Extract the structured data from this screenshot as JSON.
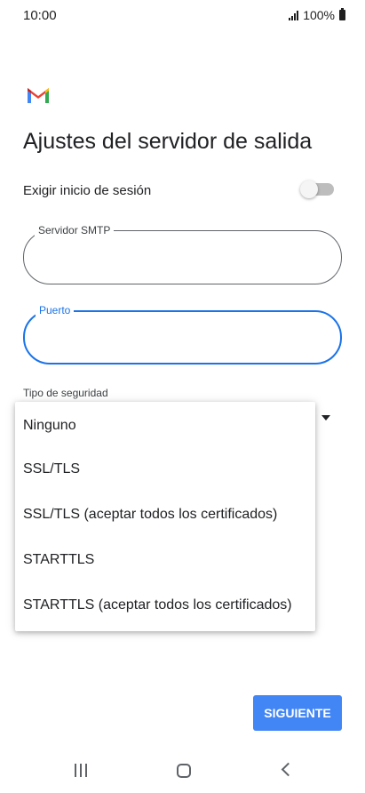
{
  "status_bar": {
    "time": "10:00",
    "battery": "100%"
  },
  "app": {
    "logo_icon": "gmail-logo-icon"
  },
  "page": {
    "title": "Ajustes del servidor de salida"
  },
  "login": {
    "label": "Exigir inicio de sesión",
    "enabled": false
  },
  "fields": {
    "smtp_label": "Servidor SMTP",
    "smtp_value": "",
    "port_label": "Puerto",
    "port_value": ""
  },
  "security": {
    "label": "Tipo de seguridad",
    "options": [
      "Ninguno",
      "SSL/TLS",
      "SSL/TLS (aceptar todos los certificados)",
      "STARTTLS",
      "STARTTLS (aceptar todos los certificados)"
    ]
  },
  "actions": {
    "next_label": "SIGUIENTE"
  },
  "colors": {
    "accent": "#1a73e8",
    "button": "#4285f4"
  },
  "nav": {
    "icons": [
      "recent-apps-icon",
      "home-icon",
      "back-icon"
    ]
  }
}
